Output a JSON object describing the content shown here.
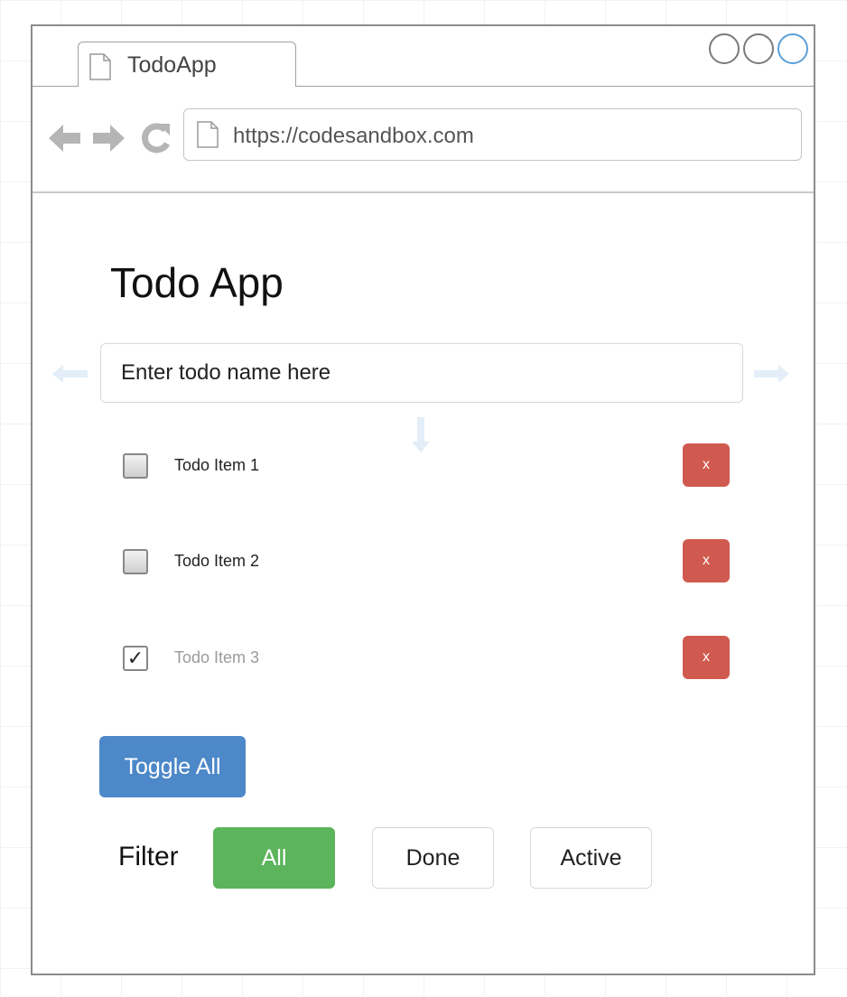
{
  "browser": {
    "tab_title": "TodoApp",
    "url": "https://codesandbox.com",
    "icons": {
      "tab": "page-icon",
      "url": "page-icon",
      "back": "back-arrow-icon",
      "forward": "forward-arrow-icon",
      "reload": "reload-icon",
      "window_controls": [
        "circle",
        "circle",
        "circle"
      ]
    }
  },
  "app": {
    "title": "Todo App",
    "input": {
      "placeholder": "Enter todo name here",
      "value": ""
    },
    "todos": [
      {
        "label": "Todo Item 1",
        "done": false,
        "delete_label": "x"
      },
      {
        "label": "Todo Item 2",
        "done": false,
        "delete_label": "x"
      },
      {
        "label": "Todo Item 3",
        "done": true,
        "delete_label": "x",
        "check_glyph": "✓"
      }
    ],
    "toggle_all_label": "Toggle All",
    "filter": {
      "label": "Filter",
      "options": [
        "All",
        "Done",
        "Active"
      ],
      "selected": "All"
    }
  },
  "colors": {
    "delete": "#d05a4f",
    "toggle": "#4d88c8",
    "filter_active": "#5cb45c",
    "hint_arrows": "#e3eef8"
  }
}
